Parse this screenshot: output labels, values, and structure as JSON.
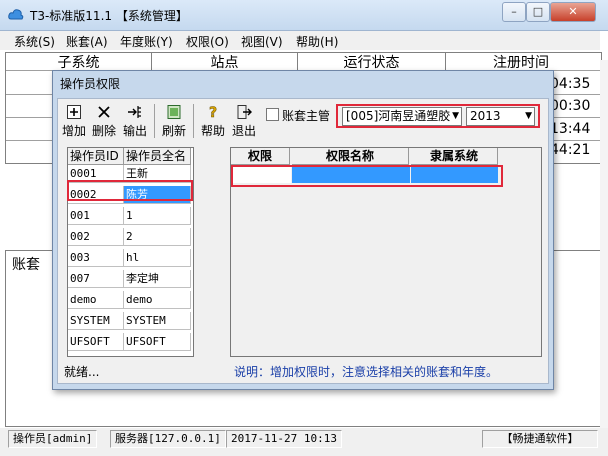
{
  "app": {
    "title": "T3-标准版11.1 【系统管理】"
  },
  "menu": [
    "系统(S)",
    "账套(A)",
    "年度账(Y)",
    "权限(O)",
    "视图(V)",
    "帮助(H)"
  ],
  "background": {
    "headers": [
      "子系统",
      "站点",
      "运行状态",
      "注册时间"
    ],
    "times": [
      "04:35",
      "00:30",
      "13:44",
      "44:21"
    ],
    "lower_label": "账套"
  },
  "dialog": {
    "title": "操作员权限",
    "toolbar": [
      "增加",
      "删除",
      "输出",
      "刷新",
      "帮助",
      "退出"
    ],
    "checkbox_label": "账套主管",
    "account_select": "[005]河南昱通塑胶",
    "year_select": "2013",
    "operator_list": {
      "headers": [
        "操作员ID",
        "操作员全名"
      ],
      "rows": [
        [
          "0001",
          "王新"
        ],
        [
          "0002",
          "陈芳"
        ],
        [
          "001",
          "1"
        ],
        [
          "002",
          "2"
        ],
        [
          "003",
          "hl"
        ],
        [
          "007",
          "李定坤"
        ],
        [
          "demo",
          "demo"
        ],
        [
          "SYSTEM",
          "SYSTEM"
        ],
        [
          "UFSOFT",
          "UFSOFT"
        ]
      ],
      "selected_index": 1
    },
    "permissions": {
      "headers": [
        "权限",
        "权限名称",
        "隶属系统"
      ]
    },
    "status": "就绪...",
    "note": "说明：增加权限时，注意选择相关的账套和年度。"
  },
  "statusbar": {
    "operator": "操作员[admin]",
    "server": "服务器[127.0.0.1]",
    "datetime": "2017-11-27 10:13",
    "brand": "【畅捷通软件】"
  },
  "colors": {
    "accent": "#3399ff",
    "highlight": "#e0283a",
    "note": "#1a3fa8"
  }
}
